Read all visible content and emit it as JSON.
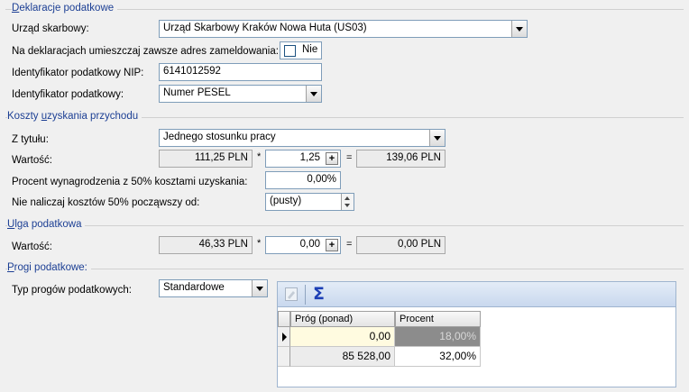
{
  "sections": {
    "deklaracje": {
      "title_prefix": "",
      "title_underline": "D",
      "title_rest": "eklaracje podatkowe"
    },
    "koszty": {
      "title_prefix": "Koszty ",
      "title_underline": "u",
      "title_rest": "zyskania przychodu"
    },
    "ulga": {
      "title_prefix": "",
      "title_underline": "U",
      "title_rest": "lga podatkowa"
    },
    "progi": {
      "title_prefix": "",
      "title_underline": "P",
      "title_rest": "rogi podatkowe:"
    }
  },
  "deklaracje": {
    "urzad_label": "Urząd skarbowy:",
    "urzad_value": "Urząd Skarbowy Kraków Nowa Huta (US03)",
    "adres_label": "Na deklaracjach umieszczaj zawsze adres zameldowania:",
    "adres_value": "Nie",
    "nip_label": "Identyfikator podatkowy NIP:",
    "nip_value": "6141012592",
    "identyfikator_label": "Identyfikator podatkowy:",
    "identyfikator_value": "Numer PESEL"
  },
  "koszty": {
    "tytul_label": "Z tytułu:",
    "tytul_value": "Jednego stosunku pracy",
    "wartosc_label": "Wartość:",
    "wartosc_base": "111,25 PLN",
    "multiply": "*",
    "wartosc_factor": "1,25",
    "plus": "+",
    "equals": "=",
    "wartosc_result": "139,06 PLN",
    "procent_label": "Procent wynagrodzenia z 50% kosztami uzyskania:",
    "procent_value": "0,00%",
    "nie_naliczaj_label": "Nie naliczaj kosztów 50% począwszy od:",
    "nie_naliczaj_value": "(pusty)"
  },
  "ulga": {
    "wartosc_label": "Wartość:",
    "wartosc_base": "46,33 PLN",
    "multiply": "*",
    "wartosc_factor": "0,00",
    "plus": "+",
    "equals": "=",
    "wartosc_result": "0,00 PLN"
  },
  "progi": {
    "typ_label": "Typ progów podatkowych:",
    "typ_value": "Standardowe",
    "columns": [
      "Próg (ponad)",
      "Procent"
    ],
    "rows": [
      {
        "prog": "0,00",
        "procent": "18,00%"
      },
      {
        "prog": "85 528,00",
        "procent": "32,00%"
      }
    ]
  },
  "icons": {
    "edit": "edit-icon",
    "sum": "sigma-icon"
  },
  "colors": {
    "section_title": "#1c3f94",
    "grid_toolbar": "#c9d8ee",
    "selected_cell": "#fffbe0",
    "grey_cell": "#8c8c8c"
  }
}
